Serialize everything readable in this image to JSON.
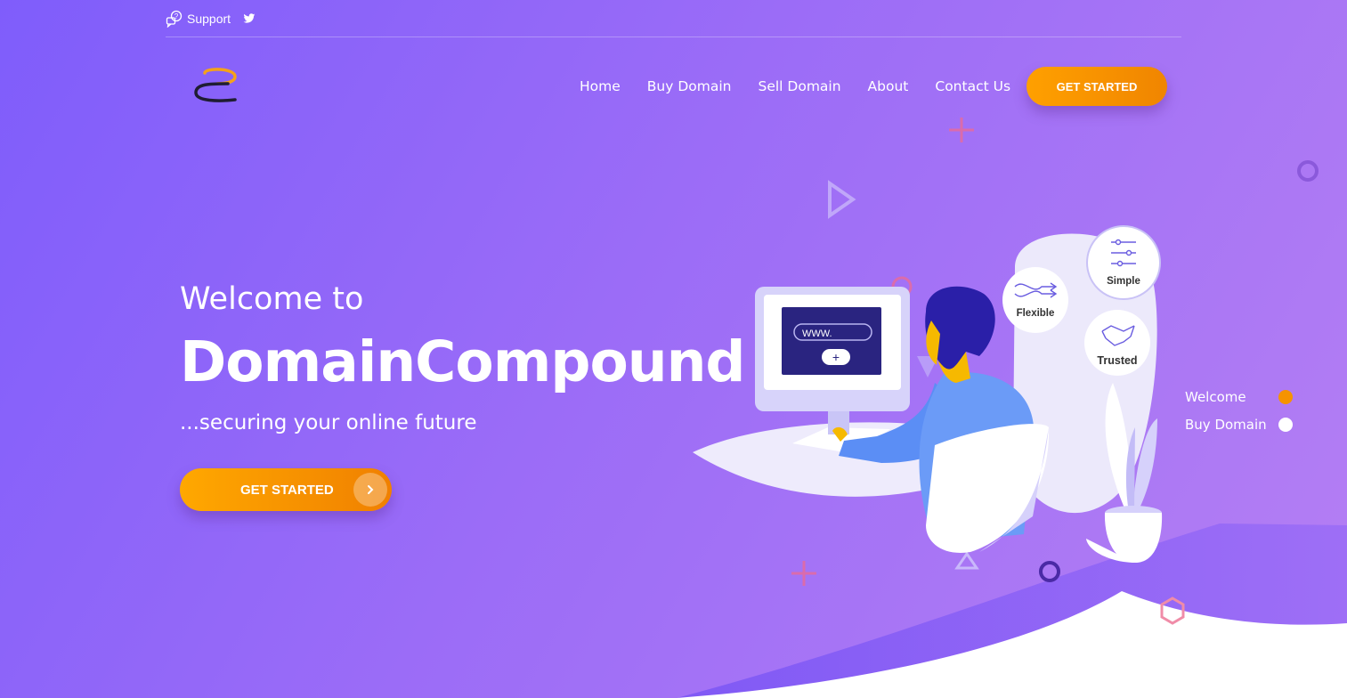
{
  "topbar": {
    "support_label": "Support",
    "support_icon": "chat-help-icon",
    "twitter_icon": "twitter-icon"
  },
  "brand": {
    "logo_icon": "domaincompound-logo"
  },
  "nav": {
    "items": [
      {
        "label": "Home"
      },
      {
        "label": "Buy Domain"
      },
      {
        "label": "Sell Domain"
      },
      {
        "label": "About"
      },
      {
        "label": "Contact Us"
      }
    ],
    "cta_label": "GET STARTED"
  },
  "hero": {
    "pre_title": "Welcome to",
    "title": "DomainCompound",
    "tagline": "...securing your online future",
    "cta_label": "GET STARTED",
    "cta_icon": "chevron-right-icon"
  },
  "illustration": {
    "screen_text": "WWW.",
    "features": [
      {
        "label": "Flexible"
      },
      {
        "label": "Simple"
      },
      {
        "label": "Trusted"
      }
    ]
  },
  "side_nav": {
    "items": [
      {
        "label": "Welcome",
        "active": true
      },
      {
        "label": "Buy Domain",
        "active": false
      }
    ]
  },
  "colors": {
    "accent": "#f59300",
    "bg_start": "#7f5dfb",
    "bg_end": "#b57ff3",
    "screen": "#2a2480"
  }
}
